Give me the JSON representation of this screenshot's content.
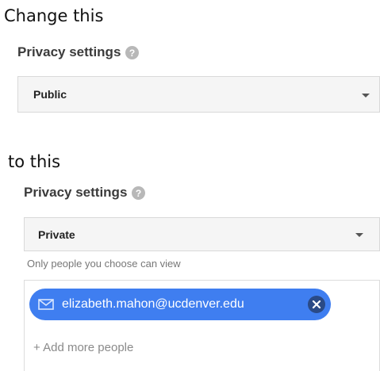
{
  "top_section": {
    "caption": "Change this",
    "label": "Privacy settings",
    "help_icon": "question-circle-icon",
    "select_value": "Public"
  },
  "bottom_section": {
    "caption": "to this",
    "label": "Privacy settings",
    "help_icon": "question-circle-icon",
    "select_value": "Private",
    "hint": "Only people you choose can view",
    "chip_email": "elizabeth.mahon@ucdenver.edu",
    "chip_icon": "mail-icon",
    "chip_close_icon": "close-icon",
    "add_more": "+ Add more people"
  },
  "colors": {
    "chip_blue": "#3f7ef0",
    "help_gray": "#b8b8b8",
    "select_bg": "#f5f5f5",
    "hint_gray": "#777777"
  }
}
